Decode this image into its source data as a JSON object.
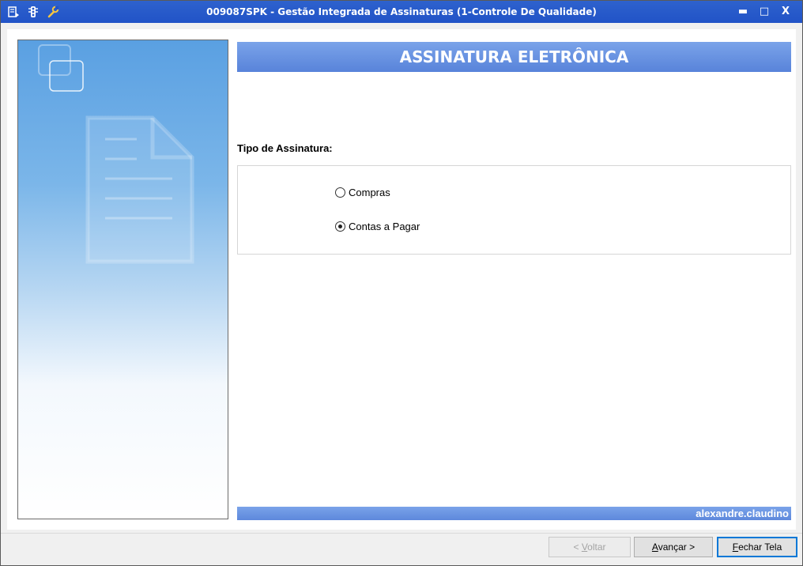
{
  "window": {
    "title": "009087SPK - Gestão Integrada de Assinaturas (1-Controle De Qualidade)",
    "icons": [
      "menu-icon",
      "traffic-light-icon",
      "wrench-icon"
    ],
    "controls": {
      "minimize": "▬",
      "maximize": "□",
      "close": "X"
    },
    "title_bar_color": "#2153c7"
  },
  "header": {
    "title": "ASSINATURA ELETRÔNICA",
    "color": "#5d88dc"
  },
  "signature_type": {
    "label": "Tipo de Assinatura:",
    "options": [
      {
        "label": "Compras",
        "selected": false
      },
      {
        "label": "Contas a Pagar",
        "selected": true
      }
    ]
  },
  "footer": {
    "user": "alexandre.claudino"
  },
  "buttons": {
    "back": {
      "label": "< Voltar",
      "hotkey": "V",
      "enabled": false
    },
    "next": {
      "label": "Avançar >",
      "hotkey": "A",
      "enabled": true
    },
    "close": {
      "label": "Fechar Tela",
      "hotkey": "F",
      "enabled": true
    }
  }
}
